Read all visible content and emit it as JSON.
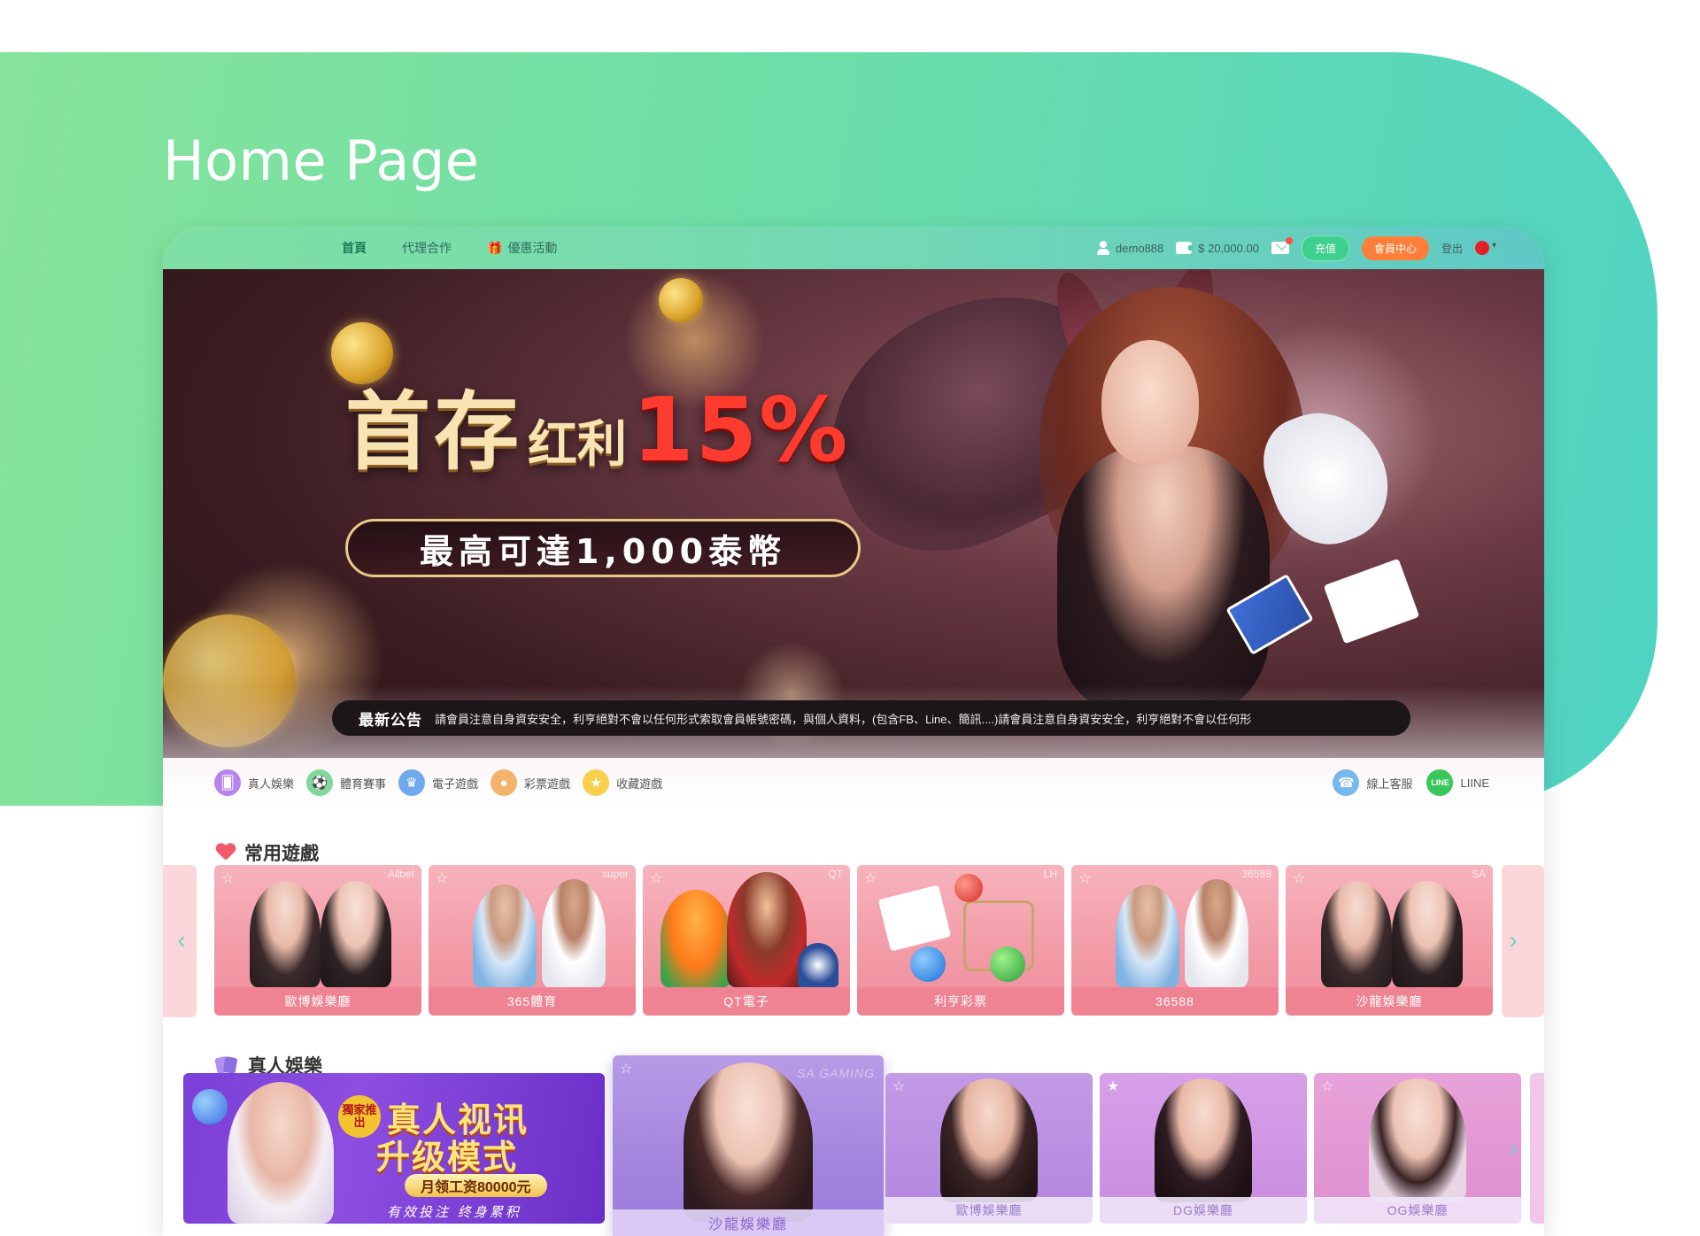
{
  "heading": "Home Page",
  "nav": {
    "links": [
      {
        "label": "首頁"
      },
      {
        "label": "代理合作"
      },
      {
        "label": "優惠活動"
      }
    ],
    "username": "demo888",
    "balance": "$ 20,000.00",
    "deposit_label": "充值",
    "member_center_label": "會員中心",
    "logout_label": "登出"
  },
  "banner": {
    "title_part1": "首存",
    "title_part2": "红利",
    "title_percent": "15%",
    "subtitle": "最高可達1,000泰幣"
  },
  "announcement": {
    "label": "最新公告",
    "text": "請會員注意自身資安安全，利亨絕對不會以任何形式索取會員帳號密碼，與個人資料，(包含FB、Line、簡訊....)請會員注意自身資安安全，利亨絕對不會以任何形"
  },
  "categories": [
    {
      "label": "真人娛樂",
      "icon": "cards-icon",
      "color": "#b784ee"
    },
    {
      "label": "體育賽事",
      "icon": "soccer-ball-icon",
      "color": "#7ed99a"
    },
    {
      "label": "電子遊戲",
      "icon": "slot-machine-icon",
      "color": "#6fa9ee"
    },
    {
      "label": "彩票遊戲",
      "icon": "lottery-ball-icon",
      "color": "#f5b36a"
    },
    {
      "label": "收藏遊戲",
      "icon": "star-icon",
      "color": "#f7cf4a"
    }
  ],
  "support": [
    {
      "label": "線上客服",
      "icon": "headset-icon",
      "color": "#76b8f0"
    },
    {
      "label": "LIINE",
      "icon": "line-icon",
      "color": "#38c75a"
    }
  ],
  "favorites": {
    "title": "常用遊戲",
    "items": [
      {
        "label": "歐博娛樂廳",
        "provider": "Allbet"
      },
      {
        "label": "365體育",
        "provider": "super"
      },
      {
        "label": "QT電子",
        "provider": "QT"
      },
      {
        "label": "利亨彩票",
        "provider": "LH"
      },
      {
        "label": "36588",
        "provider": "36588"
      },
      {
        "label": "沙龍娛樂廳",
        "provider": "SA"
      }
    ]
  },
  "live": {
    "title": "真人娛樂",
    "promo": {
      "badge": "獨家推出",
      "line1": "真人视讯",
      "line2": "升级模式",
      "pill": "月领工资80000元",
      "slogan": "有效投注 终身累积"
    },
    "featured": {
      "label": "沙龍娛樂廳",
      "provider": "SA GAMING"
    },
    "items": [
      {
        "label": "歐博娛樂廳",
        "starred": false
      },
      {
        "label": "DG娛樂廳",
        "starred": true
      },
      {
        "label": "OG娛樂廳",
        "starred": false
      }
    ]
  }
}
